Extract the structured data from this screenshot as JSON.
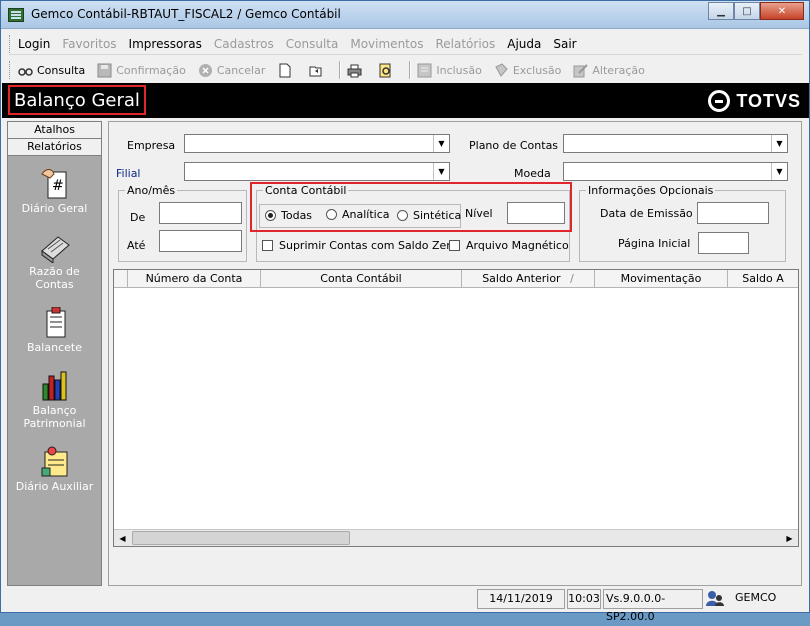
{
  "window": {
    "title": "Gemco Contábil-RBTAUT_FISCAL2 / Gemco Contábil"
  },
  "menu": [
    {
      "label": "Login",
      "enabled": true
    },
    {
      "label": "Favoritos",
      "enabled": false
    },
    {
      "label": "Impressoras",
      "enabled": true
    },
    {
      "label": "Cadastros",
      "enabled": false
    },
    {
      "label": "Consulta",
      "enabled": false
    },
    {
      "label": "Movimentos",
      "enabled": false
    },
    {
      "label": "Relatórios",
      "enabled": false
    },
    {
      "label": "Ajuda",
      "enabled": true
    },
    {
      "label": "Sair",
      "enabled": true
    }
  ],
  "toolbar": {
    "consulta": "Consulta",
    "confirmacao": "Confirmação",
    "cancelar": "Cancelar",
    "inclusao": "Inclusão",
    "exclusao": "Exclusão",
    "alteracao": "Alteração"
  },
  "banner": {
    "title": "Balanço Geral",
    "logo": "TOTVS"
  },
  "sidebar": {
    "tabs": [
      "Atalhos",
      "Relatórios"
    ],
    "items": [
      {
        "label": "Diário Geral",
        "icon": "ledger-icon"
      },
      {
        "label": "Razão de Contas",
        "icon": "account-book-icon"
      },
      {
        "label": "Balancete",
        "icon": "balance-sheet-icon"
      },
      {
        "label": "Balanço Patrimonial",
        "icon": "bar-chart-icon"
      },
      {
        "label": "Diário Auxiliar",
        "icon": "auxiliary-journal-icon"
      }
    ]
  },
  "form": {
    "empresa_label": "Empresa",
    "filial_label": "Filial",
    "plano_label": "Plano de Contas",
    "moeda_label": "Moeda",
    "anomes": {
      "legend": "Ano/mês",
      "de": "De",
      "ate": "Até"
    },
    "conta": {
      "legend": "Conta Contábil",
      "options": [
        "Todas",
        "Analítica",
        "Sintética"
      ],
      "selected": "Todas",
      "nivel_label": "Nível"
    },
    "info": {
      "legend": "Informações Opcionais",
      "data_emissao": "Data de Emissão",
      "pagina_inicial": "Página Inicial"
    },
    "suprimir": "Suprimir Contas com Saldo Zero",
    "arquivo": "Arquivo Magnético"
  },
  "grid": {
    "columns": [
      "",
      "Número da Conta",
      "Conta Contábil",
      "Saldo Anterior",
      "Movimentação",
      "Saldo A"
    ],
    "sort_indicator": "/"
  },
  "status": {
    "date": "14/11/2019",
    "time": "10:03",
    "version": "Vs.9.0.0.0-SP2.00.0",
    "user": "GEMCO"
  },
  "colors": {
    "highlight": "#e0262b",
    "banner": "#000000",
    "sidebar": "#a9a9a9"
  }
}
